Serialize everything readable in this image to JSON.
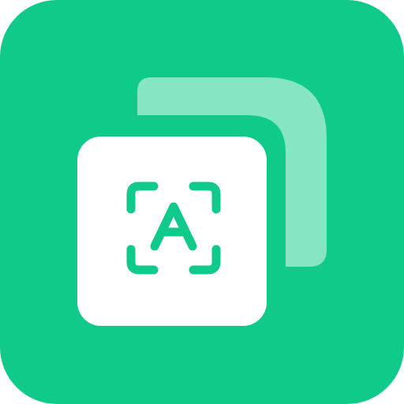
{
  "app_icon": {
    "name": "text-scan-app-icon",
    "glyph": "A",
    "colors": {
      "background": "#10CA8A",
      "back_card": "#86E6C4",
      "front_card": "#FFFFFF",
      "accent": "#10CA8A"
    },
    "icons": [
      "stacked-cards-icon",
      "scan-frame-icon",
      "letter-a-icon"
    ]
  }
}
